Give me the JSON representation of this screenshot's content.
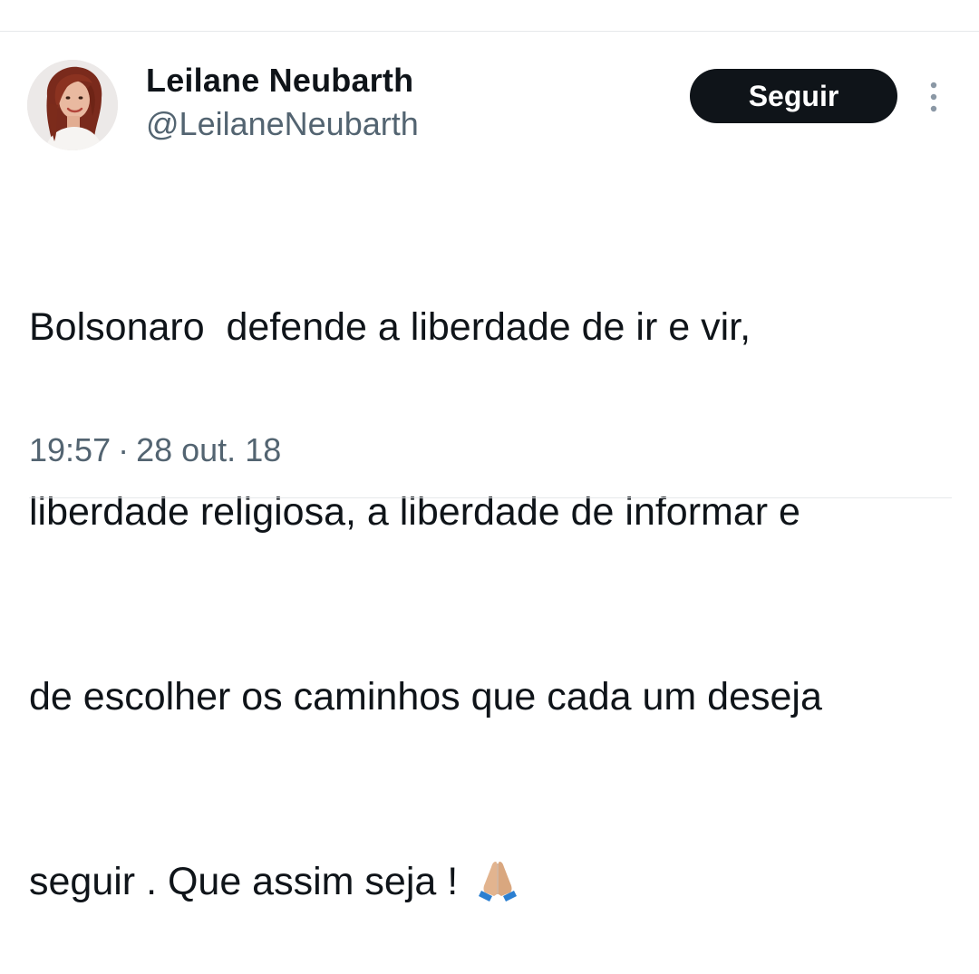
{
  "author": {
    "display_name": "Leilane Neubarth",
    "handle": "@LeilaneNeubarth",
    "avatar_icon": "profile-photo"
  },
  "actions": {
    "follow_label": "Seguir",
    "more_icon": "more-vertical-icon"
  },
  "tweet": {
    "lines": [
      "Bolsonaro  defende a liberdade de ir e vir,",
      "liberdade religiosa, a liberdade de informar e",
      "de escolher os caminhos que cada um deseja",
      "seguir . Que assim seja ! "
    ],
    "emoji": "folded-hands-emoji"
  },
  "meta": {
    "time": "19:57",
    "separator": "·",
    "date": "28 out. 18"
  },
  "colors": {
    "text": "#0f1419",
    "secondary": "#536471",
    "button_bg": "#0f1419",
    "divider": "#e6e9eb"
  }
}
